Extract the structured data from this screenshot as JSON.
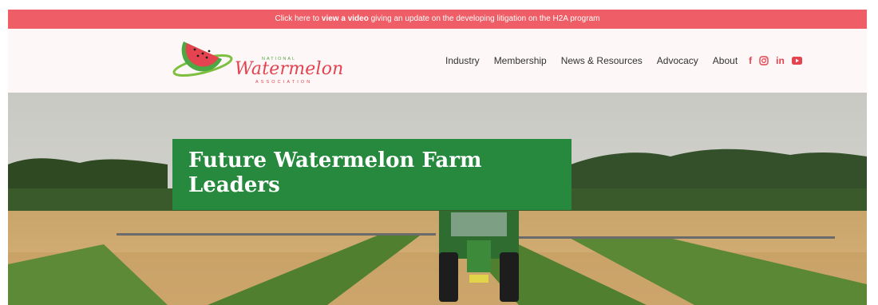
{
  "announcement": {
    "prefix": "Click here to",
    "link_text": "view a video",
    "suffix": "giving an update on the developing litigation on the H2A program"
  },
  "logo": {
    "small_text": "NATIONAL",
    "word": "Watermelon",
    "assoc_text": "ASSOCIATION"
  },
  "nav": {
    "items": [
      {
        "label": "Industry"
      },
      {
        "label": "Membership"
      },
      {
        "label": "News & Resources"
      },
      {
        "label": "Advocacy"
      },
      {
        "label": "About"
      }
    ]
  },
  "social": {
    "icons": [
      "facebook-icon",
      "instagram-icon",
      "linkedin-icon",
      "youtube-icon"
    ],
    "facebook_glyph": "f",
    "linkedin_glyph": "in"
  },
  "hero": {
    "title": "Future Watermelon Farm Leaders"
  },
  "colors": {
    "announce_bg": "#ef5d66",
    "header_bg": "#fdf7f7",
    "brand_red": "#e4434f",
    "brand_green": "#4ea743",
    "title_box": "#27893e"
  }
}
